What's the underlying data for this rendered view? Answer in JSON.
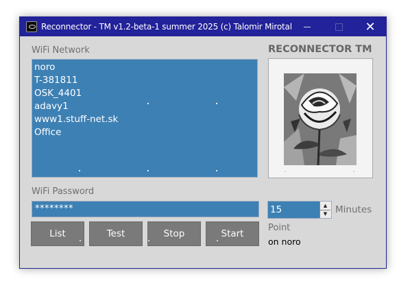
{
  "window": {
    "title": "Reconnector - TM  v1.2-beta-1  summer 2025  (c) Talomir Mirotal",
    "icon": "app-icon",
    "controls": {
      "minimize": "minimize-icon",
      "maximize": "maximize-icon",
      "close": "✕"
    }
  },
  "wifi": {
    "label": "WiFi Network",
    "networks": [
      "noro",
      "T-381811",
      "OSK_4401",
      "adavy1",
      "www1.stuff-net.sk",
      "Office"
    ]
  },
  "brand": {
    "title": "RECONNECTOR TM",
    "image": "rose-image"
  },
  "password": {
    "label": "WiFi Password",
    "value": "********"
  },
  "buttons": {
    "list": "List",
    "test": "Test",
    "stop": "Stop",
    "start": "Start"
  },
  "interval": {
    "value": "15",
    "unit": "Minutes",
    "up_icon": "▲",
    "down_icon": "▼"
  },
  "point": {
    "label": "Point",
    "value": "on noro"
  },
  "colors": {
    "titlebar": "#22229a",
    "field": "#3d80b4",
    "button": "#7a7a7a",
    "window": "#d8d8d8"
  }
}
